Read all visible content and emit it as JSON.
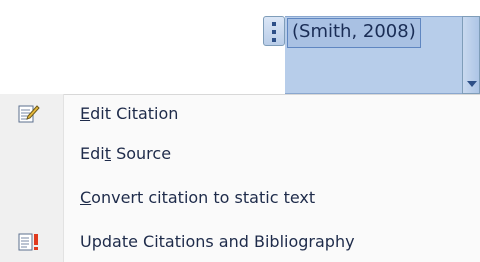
{
  "citation": {
    "text": "(Smith, 2008)"
  },
  "menu": {
    "items": [
      {
        "pre": "",
        "mnemonic": "E",
        "post": "dit Citation",
        "icon": "edit-citation-icon"
      },
      {
        "pre": "Edi",
        "mnemonic": "t",
        "post": " Source",
        "icon": ""
      },
      {
        "pre": "",
        "mnemonic": "C",
        "post": "onvert citation to static text",
        "icon": ""
      },
      {
        "pre": "Update Citations and Bibliography",
        "mnemonic": "",
        "post": "",
        "icon": "update-citations-icon"
      }
    ]
  },
  "colors": {
    "control_fill": "#b7cdea",
    "control_border": "#7f9db9",
    "menu_bg": "#fafafa",
    "gutter_bg": "#f0f0f0",
    "text": "#1e2b4a"
  }
}
